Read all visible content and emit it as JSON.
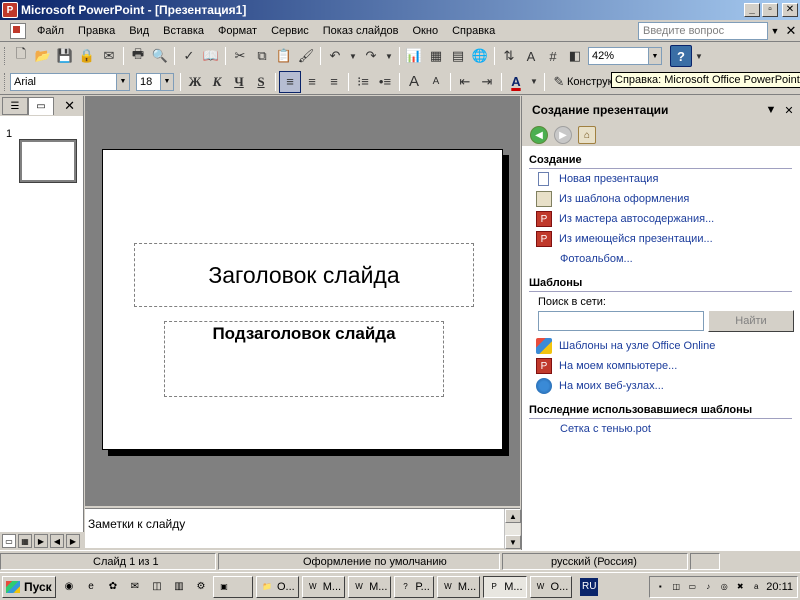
{
  "window": {
    "title": "Microsoft PowerPoint - [Презентация1]",
    "min": "_",
    "max": "▫",
    "close": "✕"
  },
  "menu": {
    "items": [
      "Файл",
      "Правка",
      "Вид",
      "Вставка",
      "Формат",
      "Сервис",
      "Показ слайдов",
      "Окно",
      "Справка"
    ],
    "help_placeholder": "Введите вопрос",
    "help_arrow": "▼",
    "close": "✕"
  },
  "toolbar": {
    "zoom": "42%",
    "font_name": "Arial",
    "font_size": "18",
    "bold": "Ж",
    "italic": "К",
    "underline": "Ч",
    "shadow": "S",
    "design": "Конструк",
    "tooltip": "Справка: Microsoft Office PowerPoint",
    "font_bigger": "A",
    "font_smaller": "A",
    "font_color": "A",
    "help_icon": "?"
  },
  "outline_pane": {
    "slide_number": "1",
    "close": "✕"
  },
  "slide": {
    "title_placeholder": "Заголовок слайда",
    "subtitle_placeholder": "Подзаголовок слайда"
  },
  "notes": {
    "placeholder": "Заметки к слайду"
  },
  "task_pane": {
    "title": "Создание презентации",
    "create_section": "Создание",
    "create_links": [
      "Новая презентация",
      "Из шаблона оформления",
      "Из мастера автосодержания...",
      "Из имеющейся презентации...",
      "Фотоальбом..."
    ],
    "templates_section": "Шаблоны",
    "search_label": "Поиск в сети:",
    "search_button": "Найти",
    "template_links": [
      "Шаблоны на узле Office Online",
      "На моем компьютере...",
      "На моих веб-узлах..."
    ],
    "recent_section": "Последние использовавшиеся шаблоны",
    "recent_links": [
      "Сетка с тенью.pot"
    ]
  },
  "status": {
    "slide": "Слайд 1 из 1",
    "design": "Оформление по умолчанию",
    "language": "русский (Россия)"
  },
  "taskbar": {
    "start": "Пуск",
    "buttons": [
      "О...",
      "М...",
      "М...",
      "Р...",
      "М...",
      "М...",
      "О..."
    ],
    "lang": "RU",
    "clock": "20:11"
  }
}
